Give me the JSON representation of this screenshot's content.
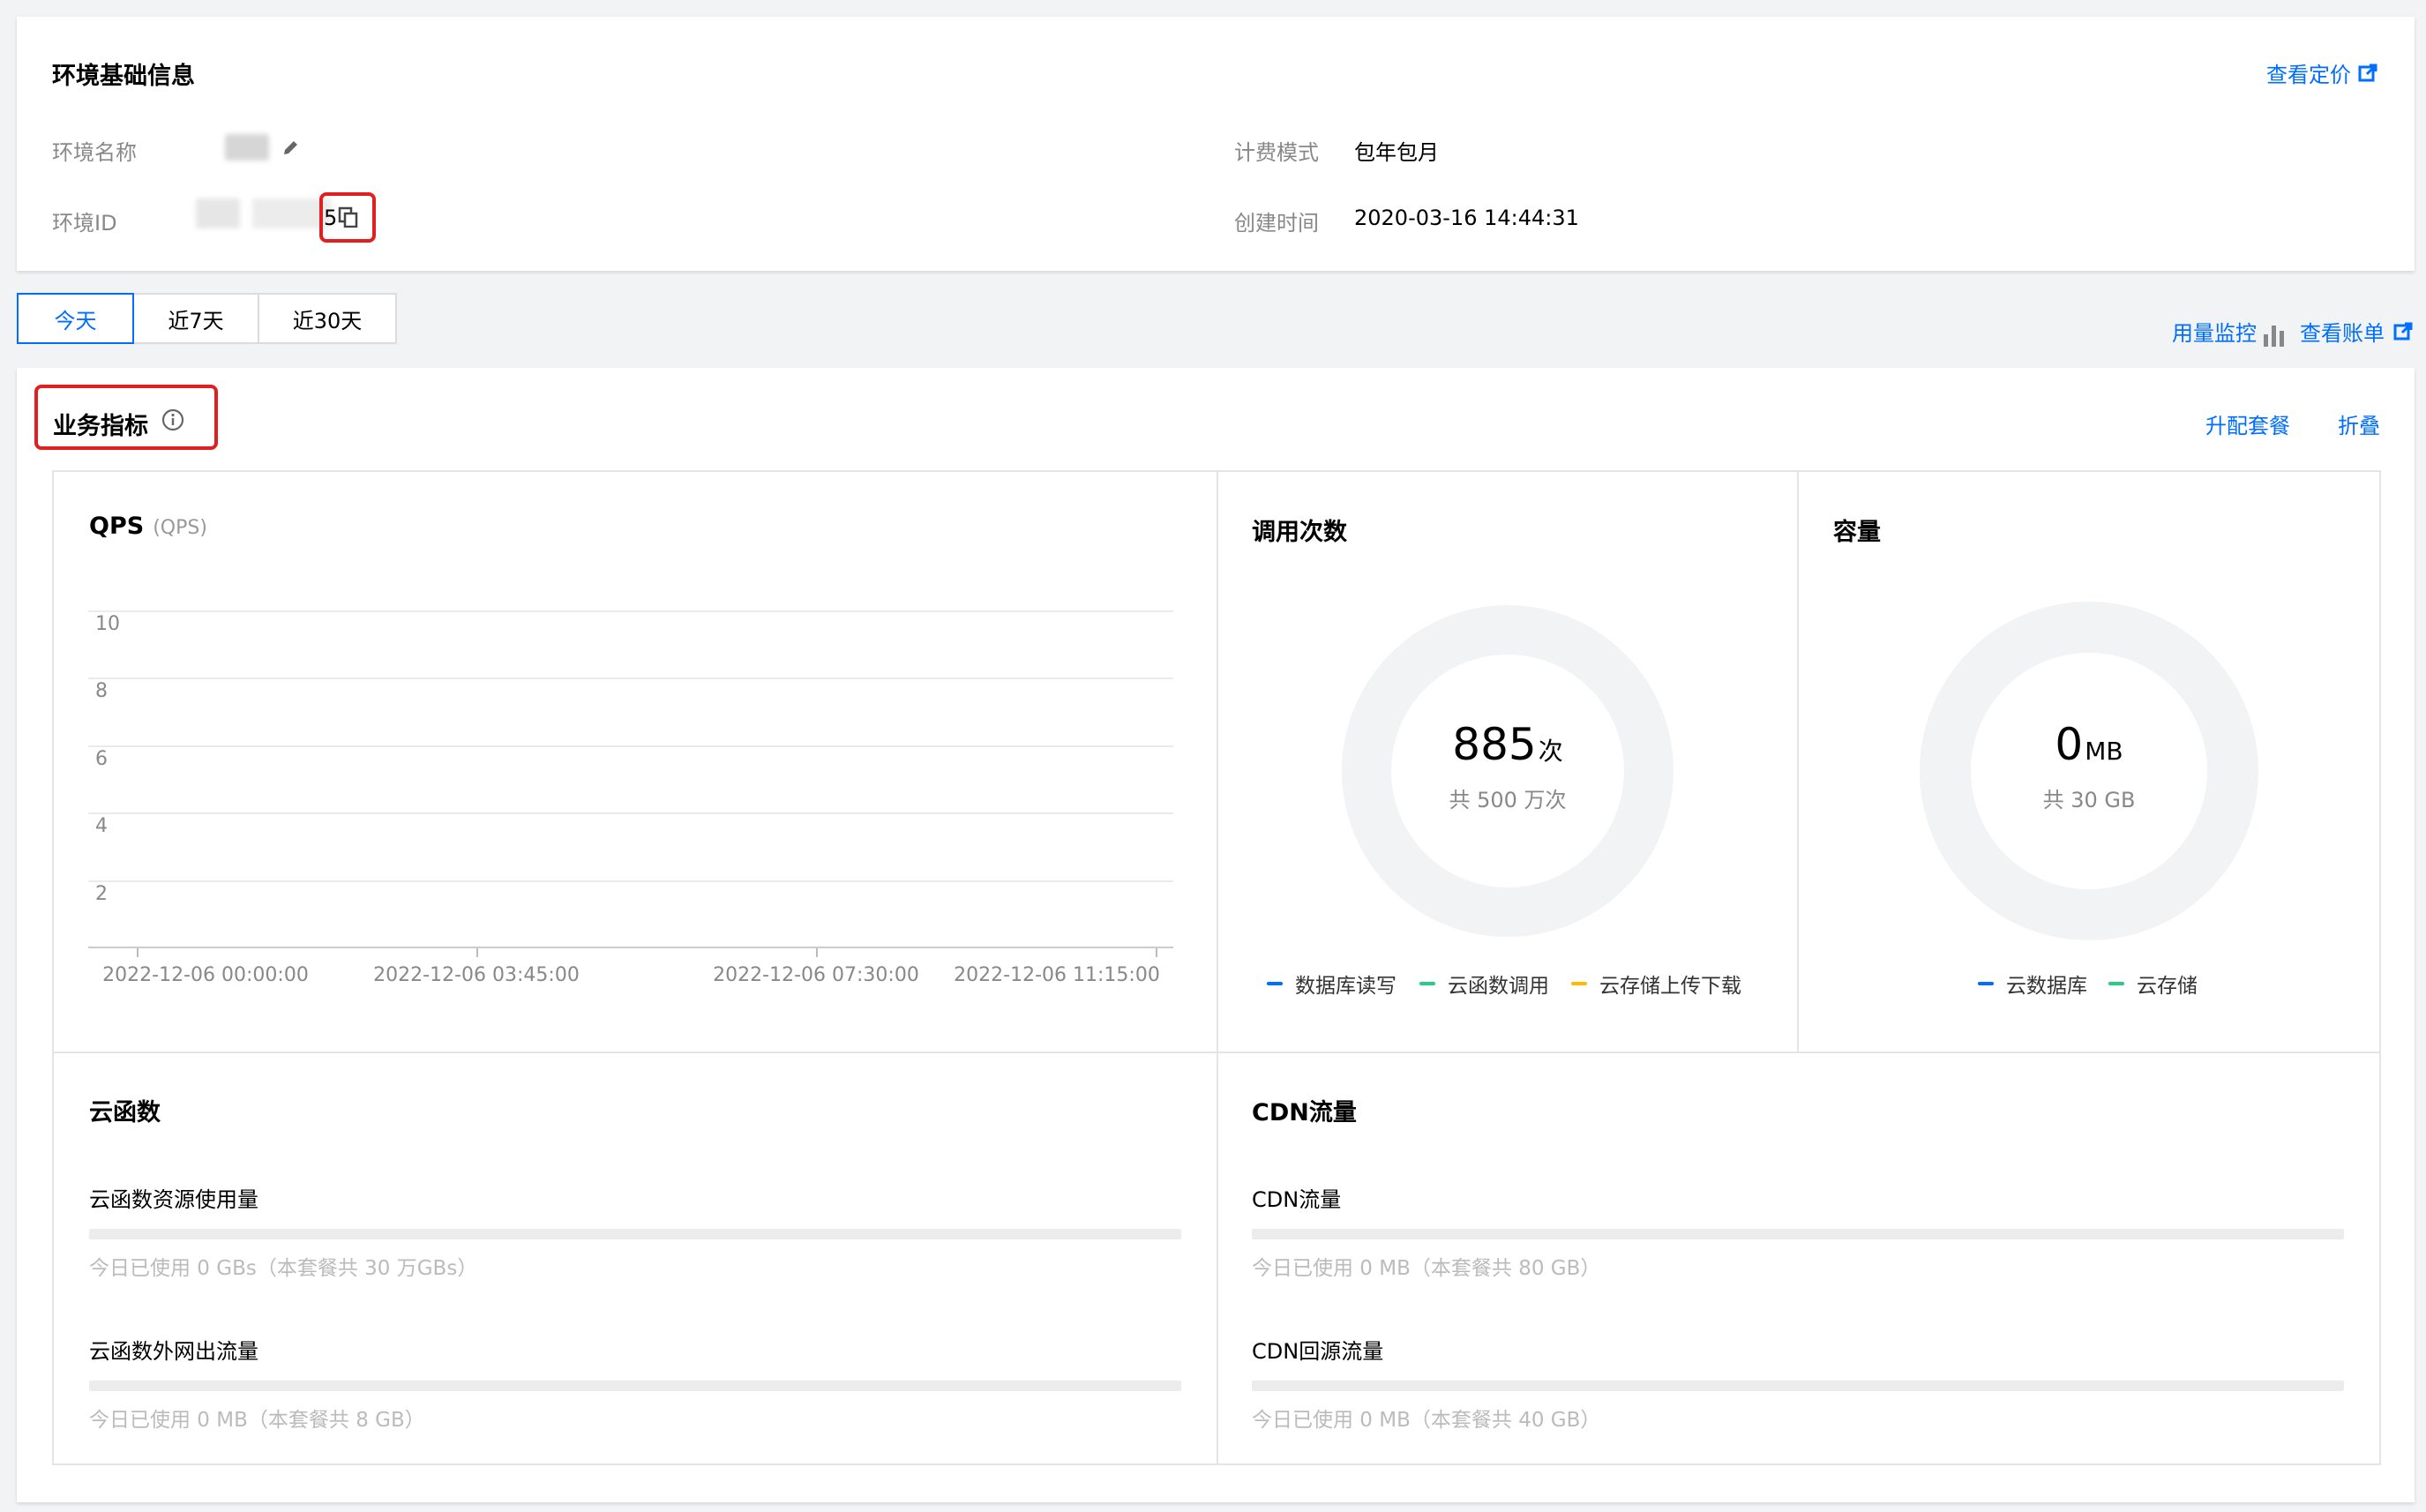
{
  "env_info": {
    "title": "环境基础信息",
    "pricing_link": "查看定价",
    "name_label": "环境名称",
    "id_label": "环境ID",
    "id_suffix": "5",
    "billing_label": "计费模式",
    "billing_value": "包年包月",
    "created_label": "创建时间",
    "created_value": "2020-03-16 14:44:31"
  },
  "range_tabs": [
    {
      "label": "今天",
      "active": true
    },
    {
      "label": "近7天",
      "active": false
    },
    {
      "label": "近30天",
      "active": false
    }
  ],
  "top_links": {
    "usage_monitor": "用量监控",
    "view_bill": "查看账单"
  },
  "metrics": {
    "title": "业务指标",
    "upgrade": "升配套餐",
    "collapse": "折叠"
  },
  "qps": {
    "title": "QPS",
    "unit": "(QPS)"
  },
  "chart_data": {
    "type": "line",
    "title": "QPS",
    "ylabel": "(QPS)",
    "ylim": [
      0,
      10
    ],
    "yticks": [
      "2",
      "4",
      "6",
      "8",
      "10"
    ],
    "xticks": [
      "2022-12-06 00:00:00",
      "2022-12-06 03:45:00",
      "2022-12-06 07:30:00",
      "2022-12-06 11:15:00"
    ],
    "series": []
  },
  "calls": {
    "title": "调用次数",
    "value": "885",
    "unit": "次",
    "total": "共 500 万次",
    "legend": [
      {
        "label": "数据库读写",
        "color": "#006eff"
      },
      {
        "label": "云函数调用",
        "color": "#29cc85"
      },
      {
        "label": "云存储上传下载",
        "color": "#ffbb00"
      }
    ]
  },
  "capacity": {
    "title": "容量",
    "value": "0",
    "unit": "MB",
    "total": "共 30 GB",
    "legend": [
      {
        "label": "云数据库",
        "color": "#006eff"
      },
      {
        "label": "云存储",
        "color": "#29cc85"
      }
    ]
  },
  "scf": {
    "title": "云函数",
    "items": [
      {
        "label": "云函数资源使用量",
        "note": "今日已使用 0 GBs（本套餐共 30 万GBs）",
        "used": 0
      },
      {
        "label": "云函数外网出流量",
        "note": "今日已使用 0 MB（本套餐共 8 GB）",
        "used": 0
      }
    ]
  },
  "cdn": {
    "title": "CDN流量",
    "items": [
      {
        "label": "CDN流量",
        "note": "今日已使用 0 MB（本套餐共 80 GB）",
        "used": 0
      },
      {
        "label": "CDN回源流量",
        "note": "今日已使用 0 MB（本套餐共 40 GB）",
        "used": 0
      }
    ]
  }
}
